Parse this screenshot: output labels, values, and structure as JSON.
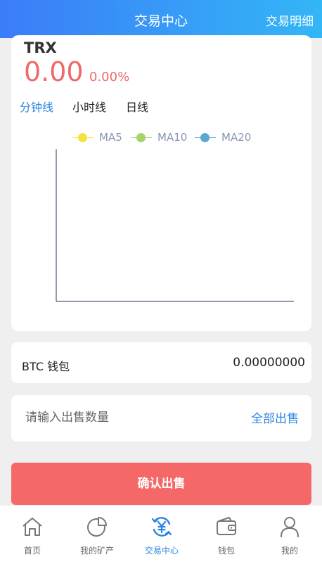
{
  "header": {
    "title": "交易中心",
    "detail_link": "交易明细"
  },
  "coin": {
    "name": "TRX",
    "price": "0.00",
    "change": "0.00%"
  },
  "tabs": [
    {
      "label": "分钟线",
      "active": true
    },
    {
      "label": "小时线",
      "active": false
    },
    {
      "label": "日线",
      "active": false
    }
  ],
  "legend": [
    {
      "name": "MA5",
      "color": "#f4e23f"
    },
    {
      "name": "MA10",
      "color": "#a6d46a"
    },
    {
      "name": "MA20",
      "color": "#5ca8cf"
    }
  ],
  "wallet": {
    "label": "BTC 钱包",
    "balance": "0.00000000"
  },
  "sell": {
    "placeholder": "请输入出售数量",
    "all_label": "全部出售",
    "value": ""
  },
  "confirm": {
    "label": "确认出售"
  },
  "colors": {
    "accent": "#2a84e0",
    "danger": "#f56868",
    "price_red": "#ee6a6a"
  },
  "tabbar": [
    {
      "label": "首页",
      "icon": "home-icon",
      "active": false
    },
    {
      "label": "我的矿产",
      "icon": "pie-chart-icon",
      "active": false
    },
    {
      "label": "交易中心",
      "icon": "yuan-exchange-icon",
      "active": true
    },
    {
      "label": "钱包",
      "icon": "wallet-icon",
      "active": false
    },
    {
      "label": "我的",
      "icon": "user-icon",
      "active": false
    }
  ]
}
